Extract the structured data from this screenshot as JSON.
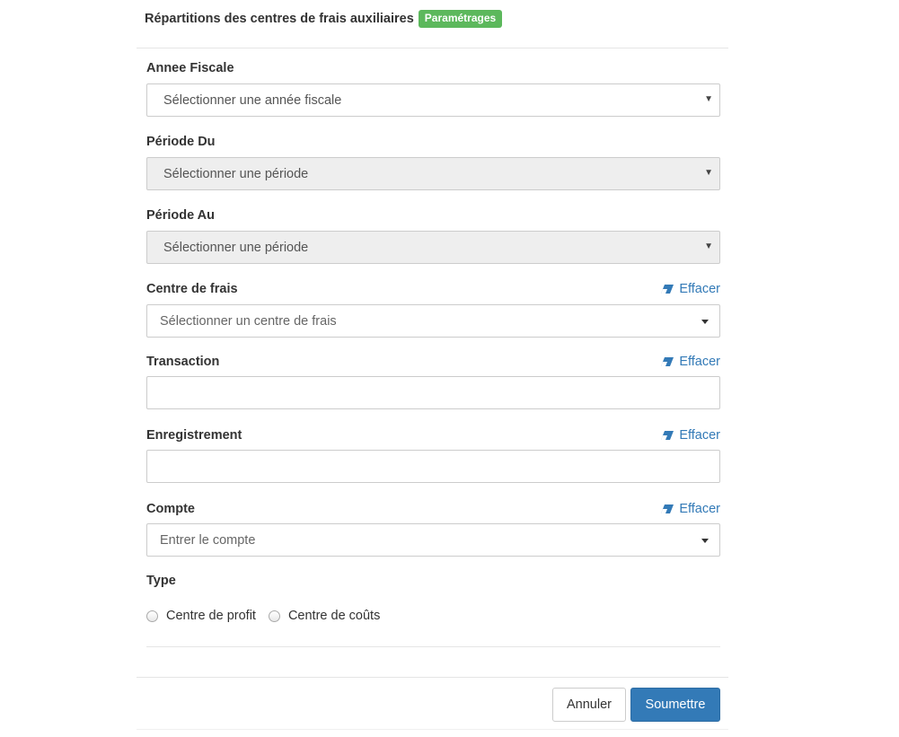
{
  "header": {
    "title": "Répartitions des centres de frais auxiliaires",
    "badge": "Paramétrages"
  },
  "colors": {
    "badge": "#5cb85c",
    "link": "#337ab7",
    "primary_button": "#337ab7",
    "disabled_field": "#eeeeee"
  },
  "clear_label": "Effacer",
  "fields": {
    "annee_fiscale": {
      "label": "Annee Fiscale",
      "placeholder": "Sélectionner une année fiscale"
    },
    "periode_du": {
      "label": "Période Du",
      "placeholder": "Sélectionner une période"
    },
    "periode_au": {
      "label": "Période Au",
      "placeholder": "Sélectionner une période"
    },
    "centre_de_frais": {
      "label": "Centre de frais",
      "placeholder": "Sélectionner un centre de frais"
    },
    "transaction": {
      "label": "Transaction",
      "value": ""
    },
    "enregistrement": {
      "label": "Enregistrement",
      "value": ""
    },
    "compte": {
      "label": "Compte",
      "placeholder": "Entrer le compte"
    }
  },
  "type": {
    "label": "Type",
    "options": [
      "Centre de profit",
      "Centre de coûts"
    ]
  },
  "buttons": {
    "cancel": "Annuler",
    "submit": "Soumettre"
  }
}
